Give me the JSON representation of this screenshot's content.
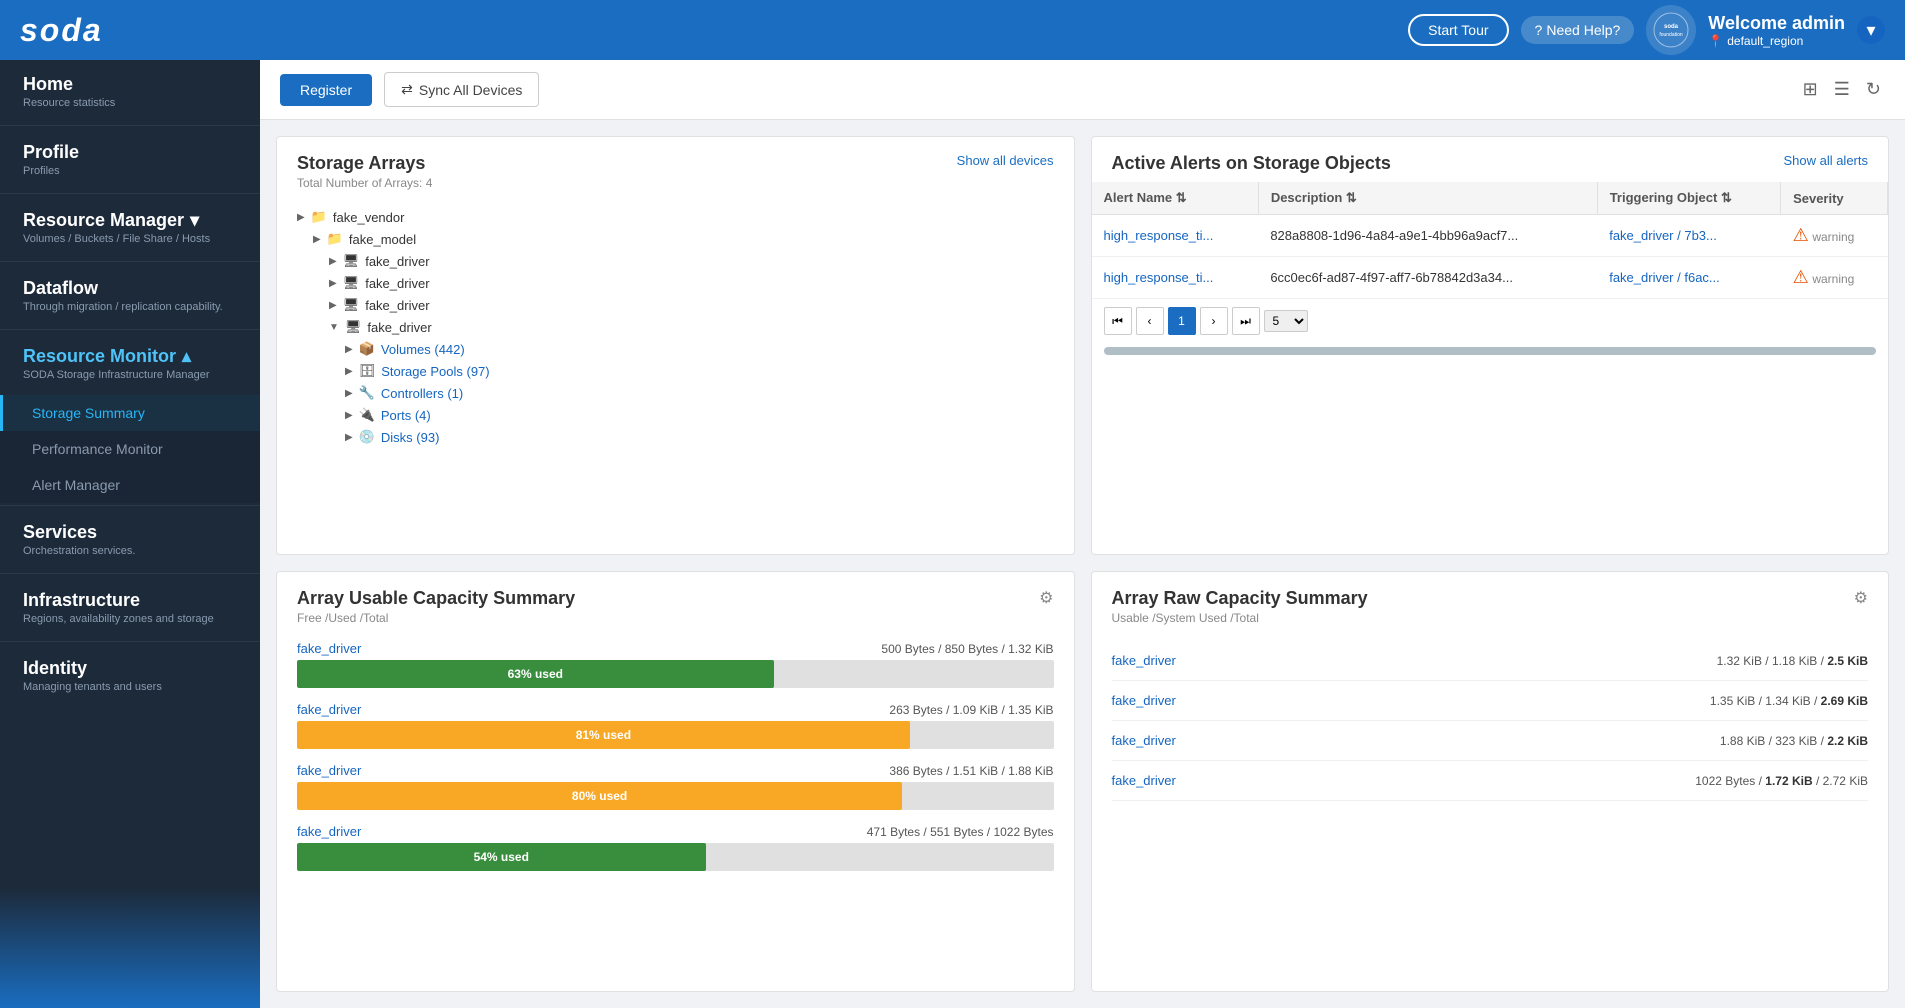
{
  "header": {
    "logo": "soda",
    "start_tour_label": "Start Tour",
    "need_help_label": "Need Help?",
    "welcome_text": "Welcome admin",
    "region": "default_region",
    "soda_icon_text": "soda\nfoundation"
  },
  "toolbar": {
    "register_label": "Register",
    "sync_label": "Sync All Devices"
  },
  "sidebar": {
    "items": [
      {
        "id": "home",
        "label": "Home",
        "subtitle": "Resource statistics",
        "active": false
      },
      {
        "id": "profile",
        "label": "Profile",
        "subtitle": "Profiles",
        "active": false
      },
      {
        "id": "resource-manager",
        "label": "Resource Manager",
        "subtitle": "Volumes / Buckets / File Share / Hosts",
        "active": false,
        "expanded": true
      },
      {
        "id": "dataflow",
        "label": "Dataflow",
        "subtitle": "Through migration / replication capability.",
        "active": false
      },
      {
        "id": "resource-monitor",
        "label": "Resource Monitor",
        "subtitle": "SODA Storage Infrastructure Manager",
        "active": true,
        "expanded": true
      },
      {
        "id": "services",
        "label": "Services",
        "subtitle": "Orchestration services.",
        "active": false
      },
      {
        "id": "infrastructure",
        "label": "Infrastructure",
        "subtitle": "Regions, availability zones and storage",
        "active": false
      },
      {
        "id": "identity",
        "label": "Identity",
        "subtitle": "Managing tenants and users",
        "active": false
      }
    ],
    "resource_monitor_sub": [
      {
        "id": "storage-summary",
        "label": "Storage Summary",
        "active": true
      },
      {
        "id": "performance-monitor",
        "label": "Performance Monitor",
        "active": false
      },
      {
        "id": "alert-manager",
        "label": "Alert Manager",
        "active": false
      }
    ]
  },
  "storage_arrays": {
    "title": "Storage Arrays",
    "show_all_label": "Show all devices",
    "total_label": "Total Number of Arrays: 4",
    "tree": {
      "vendor": "fake_vendor",
      "model": "fake_model",
      "drivers": [
        {
          "name": "fake_driver",
          "expanded": false,
          "children": []
        },
        {
          "name": "fake_driver",
          "expanded": false,
          "children": []
        },
        {
          "name": "fake_driver",
          "expanded": false,
          "children": []
        },
        {
          "name": "fake_driver",
          "expanded": true,
          "children": [
            {
              "label": "Volumes (442)"
            },
            {
              "label": "Storage Pools (97)"
            },
            {
              "label": "Controllers (1)"
            },
            {
              "label": "Ports (4)"
            },
            {
              "label": "Disks (93)"
            }
          ]
        }
      ]
    }
  },
  "active_alerts": {
    "title": "Active Alerts on Storage Objects",
    "show_all_label": "Show all alerts",
    "columns": [
      "Alert Name",
      "Description",
      "Triggering Object",
      "Severity"
    ],
    "rows": [
      {
        "alert_name": "high_response_ti...",
        "description": "828a8808-1d96-4a84-a9e1-4bb96a9acf7...",
        "triggering_object": "fake_driver / 7b3...",
        "severity": "warning"
      },
      {
        "alert_name": "high_response_ti...",
        "description": "6cc0ec6f-ad87-4f97-aff7-6b78842d3a34...",
        "triggering_object": "fake_driver / f6ac...",
        "severity": "warning"
      }
    ],
    "pagination": {
      "current_page": 1,
      "per_page": 5
    }
  },
  "array_usable_capacity": {
    "title": "Array Usable Capacity Summary",
    "subtitle": "Free /Used /Total",
    "items": [
      {
        "driver": "fake_driver",
        "values": "500 Bytes / 850 Bytes / 1.32 KiB",
        "percent": 63,
        "bar_type": "bar-green"
      },
      {
        "driver": "fake_driver",
        "values": "263 Bytes / 1.09 KiB / 1.35 KiB",
        "percent": 81,
        "bar_type": "bar-yellow"
      },
      {
        "driver": "fake_driver",
        "values": "386 Bytes / 1.51 KiB / 1.88 KiB",
        "percent": 80,
        "bar_type": "bar-yellow"
      },
      {
        "driver": "fake_driver",
        "values": "471 Bytes / 551 Bytes / 1022 Bytes",
        "percent": 54,
        "bar_type": "bar-green"
      }
    ]
  },
  "array_raw_capacity": {
    "title": "Array Raw Capacity Summary",
    "subtitle": "Usable /System Used /Total",
    "items": [
      {
        "driver": "fake_driver",
        "values": "1.32 KiB / 1.18 KiB / 2.5 KiB"
      },
      {
        "driver": "fake_driver",
        "values": "1.35 KiB / 1.34 KiB / 2.69 KiB"
      },
      {
        "driver": "fake_driver",
        "values": "1.88 KiB / 323 KiB / 2.2 KiB"
      },
      {
        "driver": "fake_driver",
        "values": "1022 Bytes / 1.72 KiB / 2.72 KiB"
      }
    ]
  }
}
